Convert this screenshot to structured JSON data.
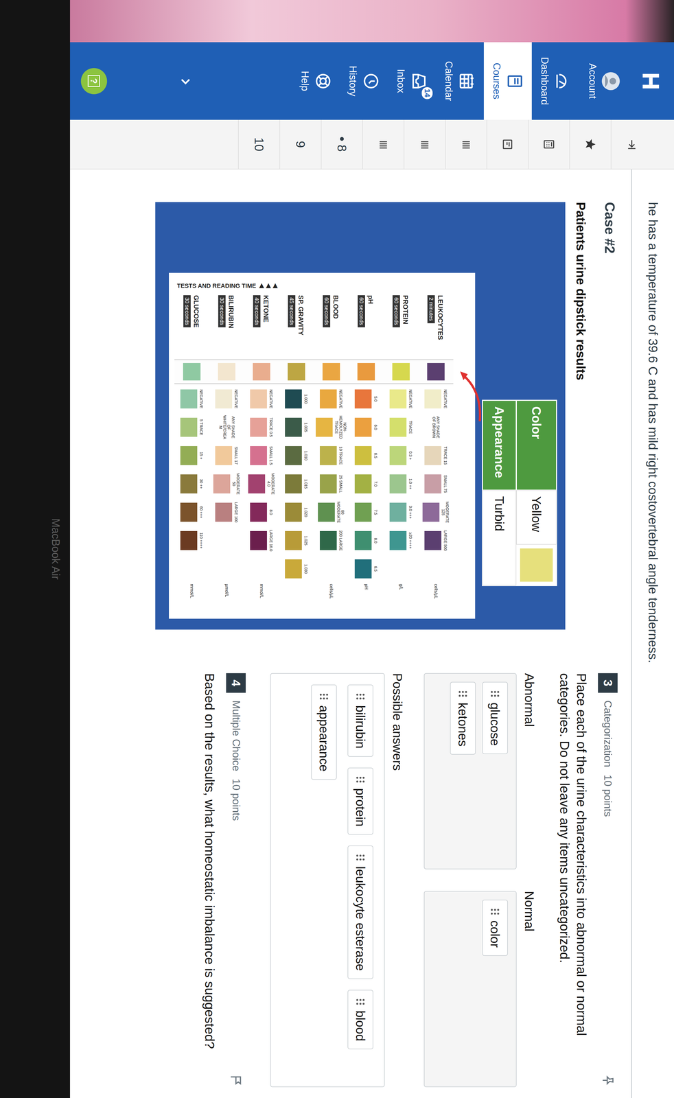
{
  "photo": {
    "device_label": "MacBook Air"
  },
  "nav": {
    "items": [
      {
        "label": "Account",
        "kind": "account",
        "selected": false
      },
      {
        "label": "Dashboard",
        "kind": "dashboard",
        "selected": false
      },
      {
        "label": "Courses",
        "kind": "courses",
        "selected": true
      },
      {
        "label": "Calendar",
        "kind": "calendar",
        "selected": false
      },
      {
        "label": "Inbox",
        "kind": "inbox",
        "selected": false,
        "badge": "14"
      },
      {
        "label": "History",
        "kind": "history",
        "selected": false
      },
      {
        "label": "Help",
        "kind": "help",
        "selected": false
      }
    ],
    "help_button": "?"
  },
  "question_nav": [
    {
      "kind": "collapse",
      "marked": false
    },
    {
      "kind": "star",
      "marked": false
    },
    {
      "kind": "calculator",
      "marked": false
    },
    {
      "kind": "document",
      "marked": false
    },
    {
      "kind": "list",
      "marked": false
    },
    {
      "kind": "list",
      "marked": false
    },
    {
      "kind": "list",
      "marked": false
    },
    {
      "kind": "number",
      "label": "8",
      "marked": true
    },
    {
      "kind": "number",
      "label": "9",
      "marked": false
    },
    {
      "kind": "number",
      "label": "10",
      "marked": false
    }
  ],
  "case": {
    "intro": "he has a temperature of 39.6 C and has mild right costovertebral angle tenderness.",
    "title": "Case #2",
    "results_heading": "Patients urine dipstick results",
    "visual": [
      {
        "label": "Color",
        "value": "Yellow",
        "swatch": "#e6e07c"
      },
      {
        "label": "Appearance",
        "value": "Turbid"
      }
    ],
    "chart": {
      "title": "TESTS AND READING TIME ▶▶▶",
      "rows": [
        {
          "name": "LEUKOCYTES",
          "time": "2 minutes",
          "result_color": "#5b3f70",
          "unit": "cells/µL",
          "chips": [
            {
              "label": "NEGATIVE",
              "color": "#f1edc9"
            },
            {
              "label": "ANY SHADE OF BROWN",
              "color": ""
            },
            {
              "label": "TRACE 15",
              "color": "#e6d6ba"
            },
            {
              "label": "SMALL 75",
              "color": "#c89ea6"
            },
            {
              "label": "MODERATE 125",
              "color": "#8d6a99"
            },
            {
              "label": "LARGE 500",
              "color": "#5b3f70"
            }
          ]
        },
        {
          "name": "PROTEIN",
          "time": "60 seconds",
          "result_color": "#d6d84e",
          "unit": "g/L",
          "chips": [
            {
              "label": "NEGATIVE",
              "color": "#e9e98a"
            },
            {
              "label": "TRACE",
              "color": "#d4df6c"
            },
            {
              "label": "0.3 +",
              "color": "#bcd67a"
            },
            {
              "label": "1.0 ++",
              "color": "#9cc68e"
            },
            {
              "label": "3.0 +++",
              "color": "#6fb09f"
            },
            {
              "label": "≥20 ++++",
              "color": "#3f9690"
            }
          ]
        },
        {
          "name": "pH",
          "time": "60 seconds",
          "result_color": "#e99a3e",
          "unit": "pH",
          "chips": [
            {
              "label": "5.0",
              "color": "#e8763c"
            },
            {
              "label": "6.0",
              "color": "#eba03f"
            },
            {
              "label": "6.5",
              "color": "#cdbf3f"
            },
            {
              "label": "7.0",
              "color": "#a3b144"
            },
            {
              "label": "7.5",
              "color": "#70a052"
            },
            {
              "label": "8.0",
              "color": "#3f8f70"
            },
            {
              "label": "8.5",
              "color": "#216f7b"
            }
          ]
        },
        {
          "name": "BLOOD",
          "time": "60 seconds",
          "result_color": "#eaa642",
          "unit": "cells/µL",
          "chips": [
            {
              "label": "NEGATIVE",
              "color": "#e9a83f"
            },
            {
              "label": "NON-HEMOLYZED TRACE",
              "color": "#e6b542"
            },
            {
              "label": "10 TRACE",
              "color": "#bcb24b"
            },
            {
              "label": "25 SMALL",
              "color": "#99a34a"
            },
            {
              "label": "80 MODERATE",
              "color": "#5f9150"
            },
            {
              "label": "200 LARGE",
              "color": "#2f6849"
            }
          ]
        },
        {
          "name": "SP. GRAVITY",
          "time": "45 seconds",
          "result_color": "#bda643",
          "chips": [
            {
              "label": "1.000",
              "color": "#1f4b52"
            },
            {
              "label": "1.005",
              "color": "#3b5b49"
            },
            {
              "label": "1.010",
              "color": "#5b6b41"
            },
            {
              "label": "1.015",
              "color": "#7c7b3a"
            },
            {
              "label": "1.020",
              "color": "#9b8b38"
            },
            {
              "label": "1.025",
              "color": "#b89b38"
            },
            {
              "label": "1.030",
              "color": "#c9a93a"
            }
          ]
        },
        {
          "name": "KETONE",
          "time": "40 seconds",
          "result_color": "#e9ad8e",
          "unit": "mmol/L",
          "chips": [
            {
              "label": "NEGATIVE",
              "color": "#f0c9a9"
            },
            {
              "label": "TRACE 0.5",
              "color": "#e6a198"
            },
            {
              "label": "SMALL 1.5",
              "color": "#d5718f"
            },
            {
              "label": "MODERATE 4.0",
              "color": "#a2426f"
            },
            {
              "label": "8.0",
              "color": "#83295a"
            },
            {
              "label": "LARGE 16.0",
              "color": "#6b1f4d"
            }
          ]
        },
        {
          "name": "BILIRUBIN",
          "time": "30 seconds",
          "result_color": "#f3e6cf",
          "unit": "µmol/L",
          "chips": [
            {
              "label": "NEGATIVE",
              "color": "#f1ead3"
            },
            {
              "label": "ANY SHADE OF WHITE/CREAM",
              "color": ""
            },
            {
              "label": "SMALL 17",
              "color": "#f1c99b"
            },
            {
              "label": "MODERATE 50",
              "color": "#dca59a"
            },
            {
              "label": "LARGE 100",
              "color": "#b98080"
            }
          ]
        },
        {
          "name": "GLUCOSE",
          "time": "30 seconds",
          "result_color": "#8fc9a2",
          "unit": "mmol/L",
          "chips": [
            {
              "label": "NEGATIVE",
              "color": "#8fc7a6"
            },
            {
              "label": "5 TRACE",
              "color": "#a6c57a"
            },
            {
              "label": "15 +",
              "color": "#93ad55"
            },
            {
              "label": "30 ++",
              "color": "#8a7a3c"
            },
            {
              "label": "60 +++",
              "color": "#7b532b"
            },
            {
              "label": "110 ++++",
              "color": "#6b3b22"
            }
          ]
        }
      ]
    }
  },
  "questions": [
    {
      "number": "3",
      "type": "Categorization",
      "points": "10 points",
      "prompt": "Place each of the urine characteristics into abnormal or normal categories. Do not leave any items uncategorized.",
      "categories": [
        {
          "label": "Abnormal",
          "items": [
            "glucose",
            "ketones"
          ]
        },
        {
          "label": "Normal",
          "items": [
            "color"
          ]
        }
      ],
      "pool_label": "Possible answers",
      "pool": [
        "bilirubin",
        "protein",
        "leukocyte esterase",
        "blood",
        "appearance"
      ]
    },
    {
      "number": "4",
      "type": "Multiple Choice",
      "points": "10 points",
      "prompt": "Based on the results, what homeostatic imbalance is suggested?"
    }
  ]
}
